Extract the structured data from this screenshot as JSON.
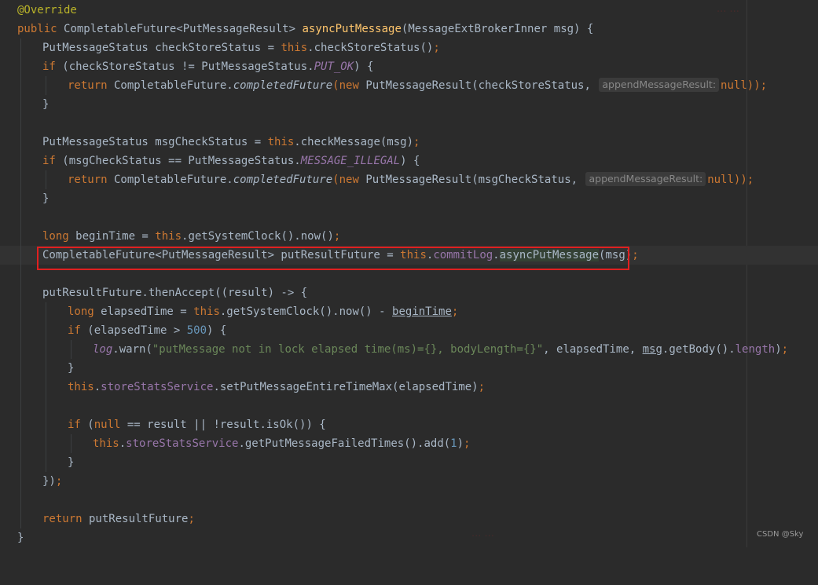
{
  "editor": {
    "language": "java",
    "highlight_box_color": "#e02020",
    "lines": [
      {
        "t": "@Override"
      },
      {
        "t": "public CompletableFuture<PutMessageResult> asyncPutMessage(MessageExtBrokerInner msg) {"
      },
      {
        "t": "PutMessageStatus checkStoreStatus = this.checkStoreStatus();"
      },
      {
        "t": "if (checkStoreStatus != PutMessageStatus.PUT_OK) {"
      },
      {
        "t": "return CompletableFuture.completedFuture(new PutMessageResult(checkStoreStatus, appendMessageResult: null));"
      },
      {
        "t": "}"
      },
      {
        "t": ""
      },
      {
        "t": "PutMessageStatus msgCheckStatus = this.checkMessage(msg);"
      },
      {
        "t": "if (msgCheckStatus == PutMessageStatus.MESSAGE_ILLEGAL) {"
      },
      {
        "t": "return CompletableFuture.completedFuture(new PutMessageResult(msgCheckStatus, appendMessageResult: null));"
      },
      {
        "t": "}"
      },
      {
        "t": ""
      },
      {
        "t": "long beginTime = this.getSystemClock().now();"
      },
      {
        "t": "CompletableFuture<PutMessageResult> putResultFuture = this.commitLog.asyncPutMessage(msg);"
      },
      {
        "t": ""
      },
      {
        "t": "putResultFuture.thenAccept((result) -> {"
      },
      {
        "t": "long elapsedTime = this.getSystemClock().now() - beginTime;"
      },
      {
        "t": "if (elapsedTime > 500) {"
      },
      {
        "t": "log.warn(\"putMessage not in lock elapsed time(ms)={}, bodyLength={}\", elapsedTime, msg.getBody().length);"
      },
      {
        "t": "}"
      },
      {
        "t": "this.storeStatsService.setPutMessageEntireTimeMax(elapsedTime);"
      },
      {
        "t": ""
      },
      {
        "t": "if (null == result || !result.isOk()) {"
      },
      {
        "t": "this.storeStatsService.getPutMessageFailedTimes().add(1);"
      },
      {
        "t": "}"
      },
      {
        "t": "});"
      },
      {
        "t": ""
      },
      {
        "t": "return putResultFuture;"
      },
      {
        "t": "}"
      }
    ],
    "tokens": {
      "l0": [
        "@Override"
      ],
      "l1": [
        "public",
        "CompletableFuture<PutMessageResult>",
        "asyncPutMessage",
        "(MessageExtBrokerInner msg) {"
      ],
      "l2": [
        "PutMessageStatus checkStoreStatus = ",
        "this",
        ".checkStoreStatus()",
        ";"
      ],
      "l3": [
        "if",
        " (checkStoreStatus != PutMessageStatus.",
        "PUT_OK",
        ") {"
      ],
      "l4": [
        "return",
        " CompletableFuture.",
        "completedFuture",
        "(",
        "new",
        " PutMessageResult(checkStoreStatus, ",
        "appendMessageResult:",
        "null",
        "));"
      ],
      "l5": [
        "}"
      ],
      "l7": [
        "PutMessageStatus msgCheckStatus = ",
        "this",
        ".checkMessage(msg)",
        ";"
      ],
      "l8": [
        "if",
        " (msgCheckStatus == PutMessageStatus.",
        "MESSAGE_ILLEGAL",
        ") {"
      ],
      "l9": [
        "return",
        " CompletableFuture.",
        "completedFuture",
        "(",
        "new",
        " PutMessageResult(msgCheckStatus, ",
        "appendMessageResult:",
        "null",
        "));"
      ],
      "l10": [
        "}"
      ],
      "l12": [
        "long",
        " beginTime = ",
        "this",
        ".getSystemClock().now()",
        ";"
      ],
      "l13": [
        "CompletableFuture<PutMessageResult> putResultFuture = ",
        "this",
        ".",
        "commitLog",
        ".",
        "asyncPutMessage",
        "(msg)",
        ";"
      ],
      "l15": [
        "putResultFuture.thenAccept((result) -> {"
      ],
      "l16": [
        "long",
        " elapsedTime = ",
        "this",
        ".getSystemClock().now() - ",
        "beginTime",
        ";"
      ],
      "l17": [
        "if",
        " (elapsedTime > ",
        "500",
        ") {"
      ],
      "l18": [
        "log",
        ".warn(",
        "\"putMessage not in lock elapsed time(ms)={}, bodyLength={}\"",
        ", elapsedTime, ",
        "msg",
        ".getBody().",
        "length",
        ")",
        ";"
      ],
      "l19": [
        "}"
      ],
      "l20": [
        "this",
        ".",
        "storeStatsService",
        ".setPutMessageEntireTimeMax(elapsedTime)",
        ";"
      ],
      "l22": [
        "if",
        " (",
        "null",
        " == result || !result.isOk()) {"
      ],
      "l23": [
        "this",
        ".",
        "storeStatsService",
        ".getPutMessageFailedTimes().add(",
        "1",
        ")",
        ";"
      ],
      "l24": [
        "}"
      ],
      "l25": [
        "})",
        ";"
      ],
      "l27": [
        "return",
        " putResultFuture",
        ";"
      ],
      "l28": [
        "}"
      ]
    }
  },
  "watermarks": {
    "top": "... ...",
    "bottom": "... ...",
    "badge": "CSDN @Sky"
  }
}
